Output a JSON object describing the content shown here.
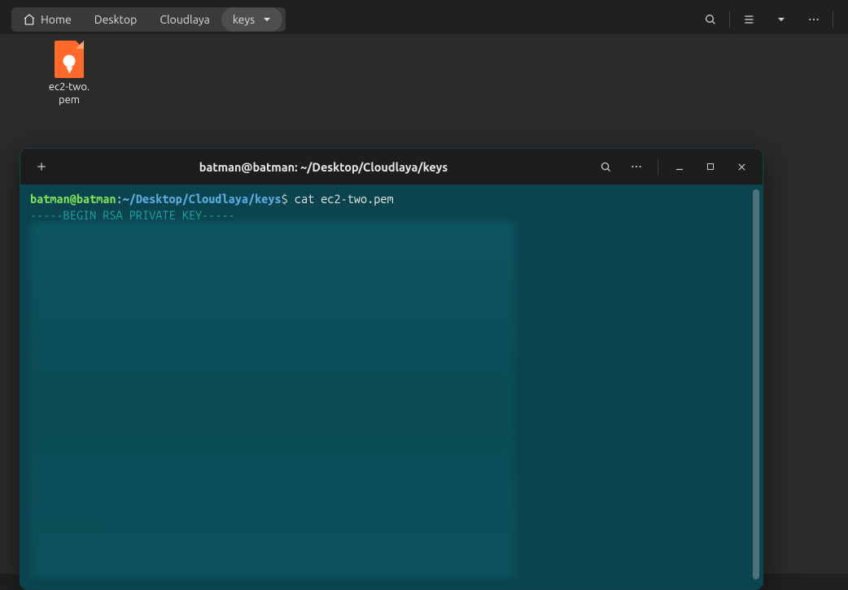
{
  "breadcrumb": {
    "home": "Home",
    "items": [
      "Desktop",
      "Cloudlaya",
      "keys"
    ],
    "active_index": 2
  },
  "toolbar_icons": {
    "search": "search-icon",
    "list_view": "list-icon",
    "view_menu": "chevron-down-icon",
    "more": "more-icon"
  },
  "file": {
    "name": "ec2-two.\npem"
  },
  "terminal": {
    "title": "batman@batman: ~/Desktop/Cloudlaya/keys",
    "prompt_user": "batman@batman",
    "prompt_sep": ":",
    "prompt_path": "~/Desktop/Cloudlaya/keys",
    "prompt_symbol": "$",
    "command": " cat ec2-two.pem",
    "output_header": "-----BEGIN RSA PRIVATE KEY-----"
  }
}
